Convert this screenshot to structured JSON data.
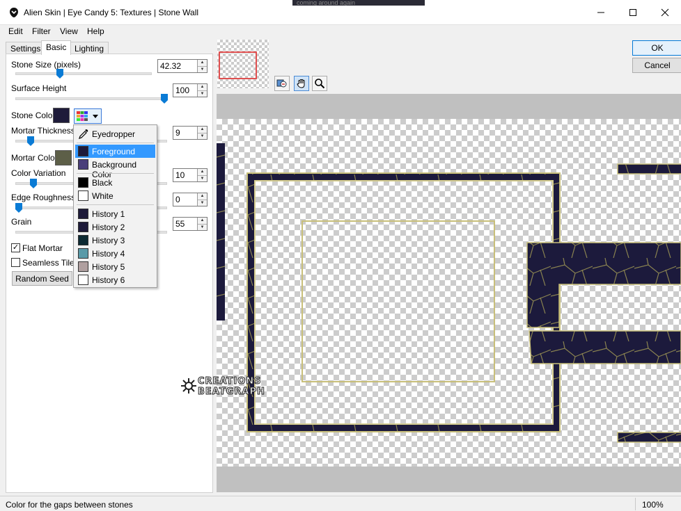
{
  "window": {
    "title": "Alien Skin | Eye Candy 5: Textures | Stone Wall",
    "background_text": "coming around again",
    "minimize_icon": "minimize-icon",
    "maximize_icon": "maximize-icon",
    "close_icon": "close-icon"
  },
  "menu": [
    "Edit",
    "Filter",
    "View",
    "Help"
  ],
  "tabs": [
    "Settings",
    "Basic",
    "Lighting"
  ],
  "active_tab": "Basic",
  "controls": {
    "stone_size": {
      "label": "Stone Size (pixels)",
      "value": "42.32",
      "fraction": 0.32
    },
    "surface_height": {
      "label": "Surface Height",
      "value": "100",
      "fraction": 1.0
    },
    "stone_color": {
      "label": "Stone Color",
      "color": "#1e1b3a"
    },
    "mortar_thickness": {
      "label": "Mortar Thickness",
      "value": "9",
      "fraction": 0.09
    },
    "mortar_color": {
      "label": "Mortar Color",
      "color": "#5d5f48"
    },
    "color_variation": {
      "label": "Color Variation",
      "value": "10",
      "fraction": 0.1
    },
    "edge_roughness": {
      "label": "Edge Roughness",
      "value": "0",
      "fraction": 0.0
    },
    "grain": {
      "label": "Grain",
      "value": "55",
      "fraction": 0.55
    }
  },
  "checkboxes": {
    "flat_mortar": {
      "label": "Flat Mortar",
      "checked": true,
      "mark": "✓"
    },
    "seamless_tile": {
      "label": "Seamless Tile",
      "checked": false
    }
  },
  "random_seed_label": "Random Seed",
  "color_menu": {
    "eyedropper": "Eyedropper",
    "items": [
      {
        "label": "Foreground Color",
        "color": "#1e1b3a",
        "selected": true
      },
      {
        "label": "Background Color",
        "color": "#4a3f7a"
      },
      {
        "label": "Black",
        "color": "#000000"
      },
      {
        "label": "White",
        "color": "#ffffff"
      },
      {
        "label": "History 1",
        "color": "#1e1b3a"
      },
      {
        "label": "History 2",
        "color": "#1e1b3a"
      },
      {
        "label": "History 3",
        "color": "#0d2a33"
      },
      {
        "label": "History 4",
        "color": "#5a9aa8"
      },
      {
        "label": "History 5",
        "color": "#b0a0a0"
      },
      {
        "label": "History 6",
        "color": "#ffffff"
      }
    ]
  },
  "buttons": {
    "ok": "OK",
    "cancel": "Cancel"
  },
  "preview": {
    "watermark": [
      "CREATIONS",
      "BEATGRAPH"
    ],
    "frame_colors": {
      "stone": "#1c1a3c",
      "mortar": "#c8bf7a"
    }
  },
  "status": {
    "text": "Color for the gaps between stones",
    "zoom": "100%"
  }
}
